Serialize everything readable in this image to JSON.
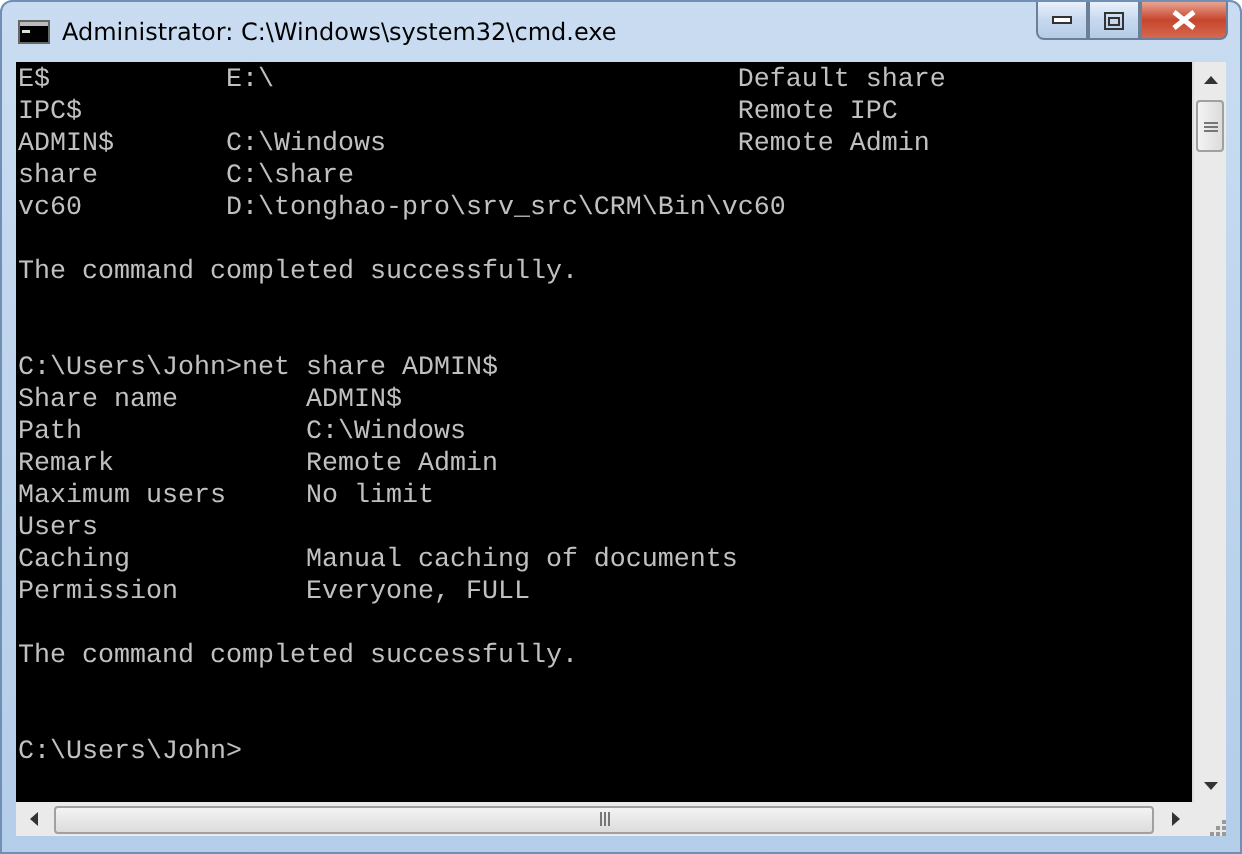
{
  "window": {
    "title": "Administrator: C:\\Windows\\system32\\cmd.exe"
  },
  "console": {
    "blocks": [
      {
        "kind": "output",
        "lines": [
          "E$           E:\\                             Default share",
          "IPC$                                         Remote IPC",
          "ADMIN$       C:\\Windows                      Remote Admin",
          "share        C:\\share",
          "vc60         D:\\tonghao-pro\\srv_src\\CRM\\Bin\\vc60"
        ]
      },
      {
        "kind": "output",
        "lines": [
          "The command completed successfully."
        ]
      },
      {
        "kind": "prompt",
        "lines": [
          "C:\\Users\\John>net share ADMIN$",
          "Share name        ADMIN$",
          "Path              C:\\Windows",
          "Remark            Remote Admin",
          "Maximum users     No limit",
          "Users",
          "Caching           Manual caching of documents",
          "Permission        Everyone, FULL"
        ]
      },
      {
        "kind": "output",
        "lines": [
          "The command completed successfully."
        ]
      },
      {
        "kind": "prompt",
        "lines": [
          "C:\\Users\\John>"
        ]
      }
    ]
  }
}
